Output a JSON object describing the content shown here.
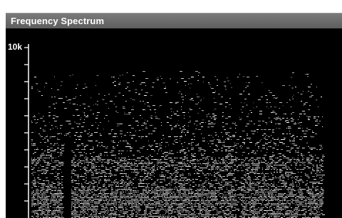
{
  "window": {
    "title": "Frequency Spectrum"
  },
  "spectrogram": {
    "y_axis": {
      "tick_labels": [
        "10k"
      ]
    }
  },
  "colors": {
    "titlebar": "#6b6b6b",
    "background": "#000000",
    "axis": "#ffffff"
  }
}
